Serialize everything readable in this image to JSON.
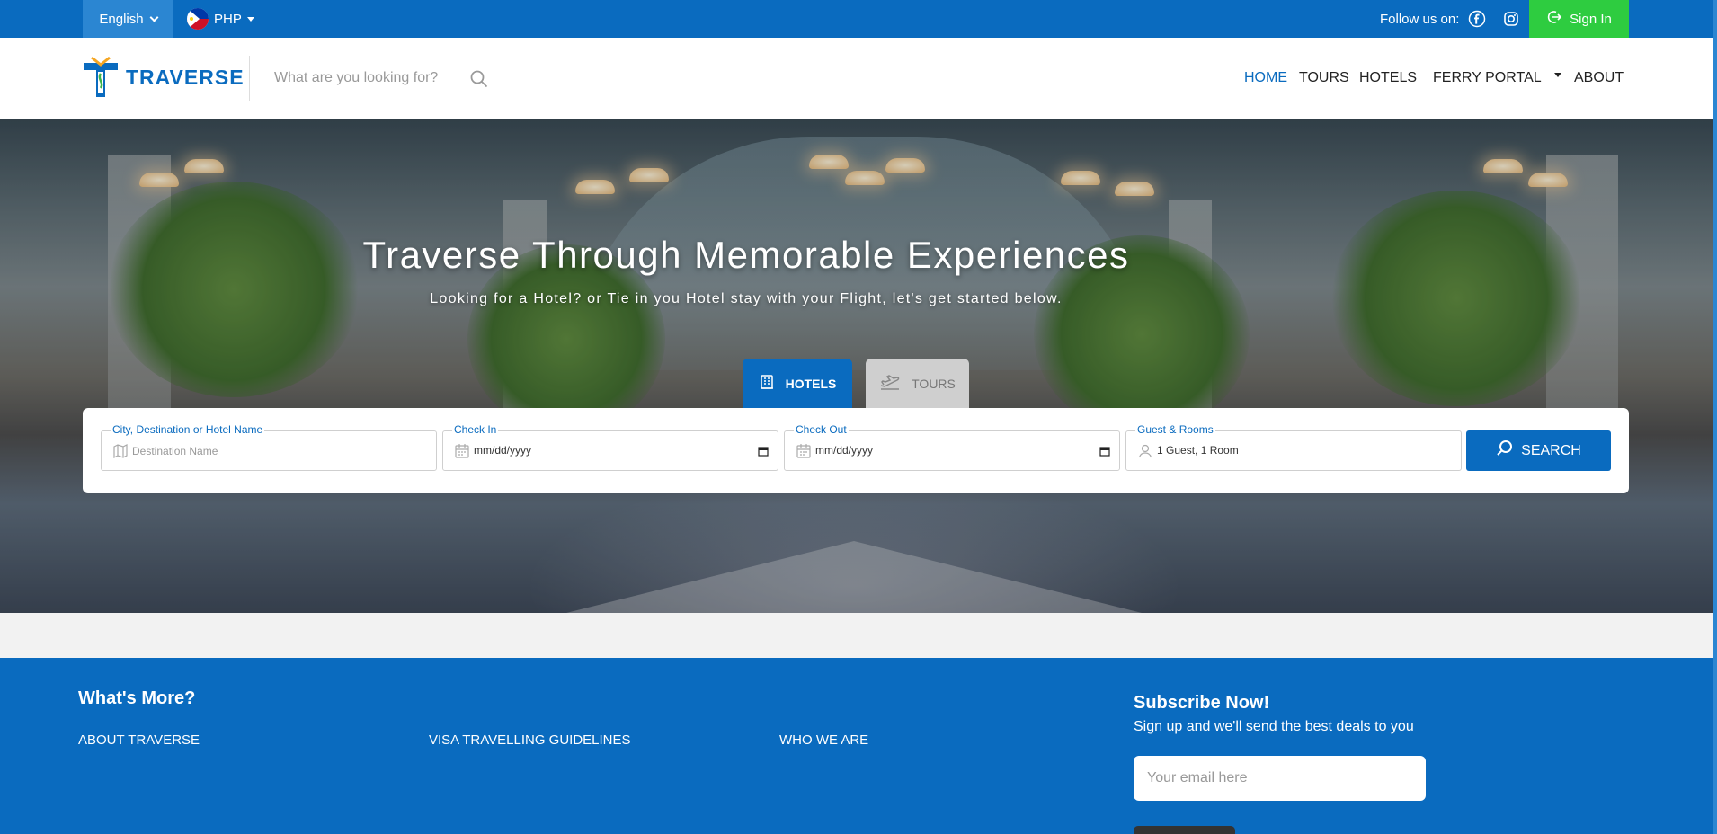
{
  "topbar": {
    "language": "English",
    "currency": "PHP",
    "follow_label": "Follow us on:",
    "sign_in": "Sign In",
    "icons": {
      "facebook": "facebook-icon",
      "instagram": "instagram-icon",
      "signin": "sign-in-icon"
    }
  },
  "header": {
    "logo_text": "TRAVERSE",
    "search_placeholder": "What are you looking for?",
    "nav": {
      "home": "HOME",
      "tours": "TOURS",
      "hotels": "HOTELS",
      "ferry": "FERRY PORTAL",
      "about": "ABOUT"
    },
    "active_nav": "HOME"
  },
  "hero": {
    "title": "Traverse Through Memorable Experiences",
    "subtitle": "Looking for a Hotel? or Tie in you Hotel stay with your Flight, let's get started below."
  },
  "tabs": {
    "hotels": "HOTELS",
    "tours": "TOURS",
    "active": "HOTELS"
  },
  "search_form": {
    "destination": {
      "label": "City, Destination or Hotel Name",
      "placeholder": "Destination Name"
    },
    "check_in": {
      "label": "Check In",
      "placeholder": "mm/dd/yyyy"
    },
    "check_out": {
      "label": "Check Out",
      "placeholder": "mm/dd/yyyy"
    },
    "guests": {
      "label": "Guest & Rooms",
      "value": "1 Guest, 1 Room"
    },
    "submit": "SEARCH"
  },
  "footer": {
    "heading": "What's More?",
    "links": {
      "about": "ABOUT TRAVERSE",
      "visa": "VISA TRAVELLING GUIDELINES",
      "who": "WHO WE ARE"
    },
    "subscribe": {
      "title": "Subscribe Now!",
      "text": "Sign up and we'll send the best deals to you",
      "email_placeholder": "Your email here"
    }
  },
  "colors": {
    "brand_blue": "#0a6bbf",
    "sign_in_green": "#2ecc40",
    "tab_inactive": "#cfcfcf"
  }
}
